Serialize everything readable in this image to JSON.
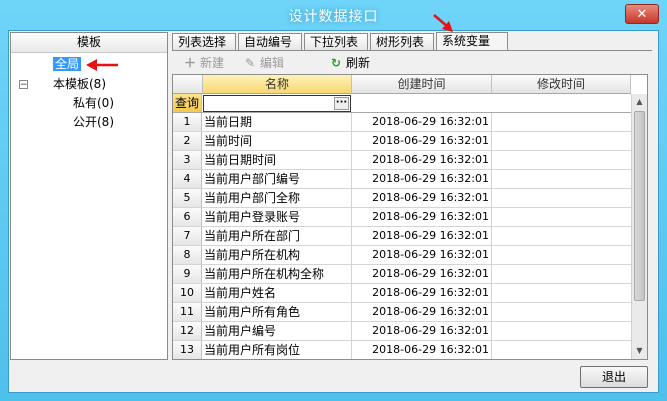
{
  "window": {
    "title": "设计数据接口",
    "close_glyph": "✕"
  },
  "left_panel": {
    "header": "模板",
    "tree": [
      {
        "label": "全局",
        "selected": true
      },
      {
        "label": "本模板(8)",
        "expander": "−"
      },
      {
        "label": "私有(0)"
      },
      {
        "label": "公开(8)"
      }
    ]
  },
  "tabs": [
    {
      "label": "列表选择"
    },
    {
      "label": "自动编号"
    },
    {
      "label": "下拉列表"
    },
    {
      "label": "树形列表"
    },
    {
      "label": "系统变量",
      "active": true
    }
  ],
  "toolbar": {
    "new_label": "新建",
    "new_icon": "plus-icon",
    "edit_label": "编辑",
    "edit_icon": "pencil-icon",
    "refresh_label": "刷新",
    "refresh_icon": "refresh-icon"
  },
  "grid": {
    "columns": [
      "名称",
      "创建时间",
      "修改时间"
    ],
    "filter_label": "查询",
    "filter_value": "",
    "ellipsis": "···",
    "rows": [
      {
        "num": "1",
        "name": "当前日期",
        "created": "2018-06-29 16:32:01"
      },
      {
        "num": "2",
        "name": "当前时间",
        "created": "2018-06-29 16:32:01"
      },
      {
        "num": "3",
        "name": "当前日期时间",
        "created": "2018-06-29 16:32:01"
      },
      {
        "num": "4",
        "name": "当前用户部门编号",
        "created": "2018-06-29 16:32:01"
      },
      {
        "num": "5",
        "name": "当前用户部门全称",
        "created": "2018-06-29 16:32:01"
      },
      {
        "num": "6",
        "name": "当前用户登录账号",
        "created": "2018-06-29 16:32:01"
      },
      {
        "num": "7",
        "name": "当前用户所在部门",
        "created": "2018-06-29 16:32:01"
      },
      {
        "num": "8",
        "name": "当前用户所在机构",
        "created": "2018-06-29 16:32:01"
      },
      {
        "num": "9",
        "name": "当前用户所在机构全称",
        "created": "2018-06-29 16:32:01"
      },
      {
        "num": "10",
        "name": "当前用户姓名",
        "created": "2018-06-29 16:32:01"
      },
      {
        "num": "11",
        "name": "当前用户所有角色",
        "created": "2018-06-29 16:32:01"
      },
      {
        "num": "12",
        "name": "当前用户编号",
        "created": "2018-06-29 16:32:01"
      },
      {
        "num": "13",
        "name": "当前用户所有岗位",
        "created": "2018-06-29 16:32:01"
      }
    ]
  },
  "footer": {
    "exit_label": "退出"
  },
  "colors": {
    "title_bar": "#5cc8f2",
    "selection": "#3399ff",
    "annotation_arrow": "#e81010",
    "name_header": "#f7d873"
  }
}
